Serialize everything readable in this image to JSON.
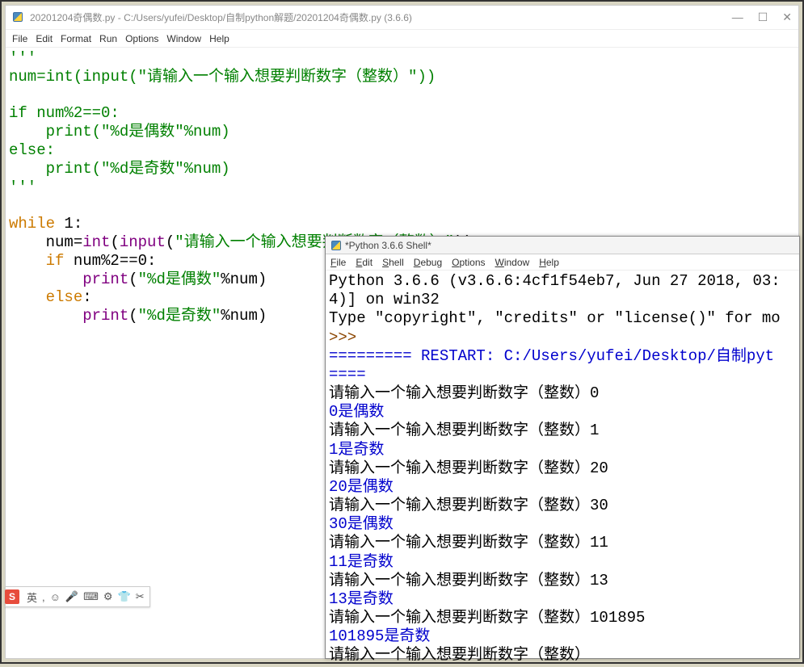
{
  "editor": {
    "title": "20201204奇偶数.py - C:/Users/yufei/Desktop/自制python解题/20201204奇偶数.py (3.6.6)",
    "menu": [
      "File",
      "Edit",
      "Format",
      "Run",
      "Options",
      "Window",
      "Help"
    ],
    "winbtns": {
      "min": "—",
      "max": "☐",
      "close": "✕"
    },
    "code": {
      "l1": "'''",
      "l2_a": "num=",
      "l2_b": "int",
      "l2_c": "(",
      "l2_d": "input",
      "l2_e": "(",
      "l2_f": "\"请输入一个输入想要判断数字（整数）\"",
      "l2_g": "))",
      "l3": "",
      "l4_a": "if num%2==0:",
      "l5_a": "    print(",
      "l5_b": "\"%d是偶数\"",
      "l5_c": "%num)",
      "l6_a": "else:",
      "l7_a": "    print(",
      "l7_b": "\"%d是奇数\"",
      "l7_c": "%num)",
      "l8": "'''",
      "l9": "",
      "l10_a": "while",
      "l10_b": " 1:",
      "l11_a": "    num=",
      "l11_b": "int",
      "l11_c": "(",
      "l11_d": "input",
      "l11_e": "(",
      "l11_f": "\"请输入一个输入想要判断数字（整数）\"",
      "l11_g": "))",
      "l12_a": "    ",
      "l12_b": "if",
      "l12_c": " num%2==0:",
      "l13_a": "        ",
      "l13_b": "print",
      "l13_c": "(",
      "l13_d": "\"%d是偶数\"",
      "l13_e": "%num)",
      "l14_a": "    ",
      "l14_b": "else",
      "l14_c": ":",
      "l15_a": "        ",
      "l15_b": "print",
      "l15_c": "(",
      "l15_d": "\"%d是奇数\"",
      "l15_e": "%num)"
    }
  },
  "shell": {
    "title": "*Python 3.6.6 Shell*",
    "menu": [
      "File",
      "Edit",
      "Shell",
      "Debug",
      "Options",
      "Window",
      "Help"
    ],
    "hdr1": "Python 3.6.6 (v3.6.6:4cf1f54eb7, Jun 27 2018, 03:",
    "hdr2": "4)] on win32",
    "hdr3": "Type \"copyright\", \"credits\" or \"license()\" for mo",
    "prompt": ">>> ",
    "restart1": "========= RESTART: C:/Users/yufei/Desktop/自制pyt",
    "restart2": "====",
    "io": [
      {
        "p": "请输入一个输入想要判断数字（整数）",
        "i": "0",
        "o": "0是偶数"
      },
      {
        "p": "请输入一个输入想要判断数字（整数）",
        "i": "1",
        "o": "1是奇数"
      },
      {
        "p": "请输入一个输入想要判断数字（整数）",
        "i": "20",
        "o": "20是偶数"
      },
      {
        "p": "请输入一个输入想要判断数字（整数）",
        "i": "30",
        "o": "30是偶数"
      },
      {
        "p": "请输入一个输入想要判断数字（整数）",
        "i": "11",
        "o": "11是奇数"
      },
      {
        "p": "请输入一个输入想要判断数字（整数）",
        "i": "13",
        "o": "13是奇数"
      },
      {
        "p": "请输入一个输入想要判断数字（整数）",
        "i": "101895",
        "o": "101895是奇数"
      }
    ],
    "lastprompt": "请输入一个输入想要判断数字（整数）"
  },
  "ime": {
    "logo": "S",
    "label": "英",
    "icons": [
      ",",
      "☺",
      "🎤",
      "⌨",
      "⚙",
      "👕",
      "✂"
    ]
  }
}
